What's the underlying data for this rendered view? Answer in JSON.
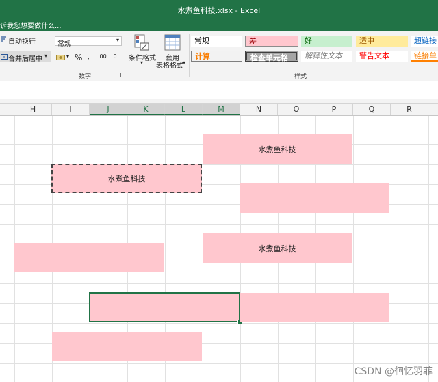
{
  "app": {
    "title": "水煮鱼科技.xlsx - Excel",
    "tell_me": "诉我您想要做什么..."
  },
  "ribbon": {
    "wrap_text": "自动换行",
    "merge_center": "合并后居中",
    "number_format": "常规",
    "percent_symbol": "%",
    "comma_symbol": ",",
    "decimal_increase": ".00",
    "decimal_decrease": ".0",
    "number_group_label": "数字",
    "conditional_format": "条件格式",
    "format_as_table_1": "套用",
    "format_as_table_2": "表格格式",
    "styles_group_label": "样式",
    "styles": [
      {
        "label": "常规",
        "bg": "#ffffff",
        "color": "#000000"
      },
      {
        "label": "差",
        "bg": "#ffc7ce",
        "color": "#9c0006"
      },
      {
        "label": "好",
        "bg": "#c6efce",
        "color": "#006100"
      },
      {
        "label": "适中",
        "bg": "#ffeb9c",
        "color": "#9c5700"
      },
      {
        "label": "超链接",
        "bg": "#ffffff",
        "color": "#0563c1"
      },
      {
        "label": "计算",
        "bg": "#f2f2f2",
        "color": "#fa7d00"
      },
      {
        "label": "检查单元格",
        "bg": "#a5a5a5",
        "color": "#ffffff"
      },
      {
        "label": "解释性文本",
        "bg": "#ffffff",
        "color": "#7f7f7f"
      },
      {
        "label": "警告文本",
        "bg": "#ffffff",
        "color": "#ff0000"
      },
      {
        "label": "链接单",
        "bg": "#ffffff",
        "color": "#fa7d00"
      }
    ]
  },
  "columns": [
    "H",
    "I",
    "J",
    "K",
    "L",
    "M",
    "N",
    "O",
    "P",
    "Q",
    "R"
  ],
  "selected_columns": [
    "J",
    "K",
    "L",
    "M"
  ],
  "cells": {
    "m_merge": "水煮鱼科技",
    "i_merge": "水煮鱼科技",
    "m_merge2": "水煮鱼科技"
  },
  "colors": {
    "accent": "#217346",
    "fill_bad": "#ffc7ce"
  },
  "watermark": "CSDN @徊忆羽菲"
}
